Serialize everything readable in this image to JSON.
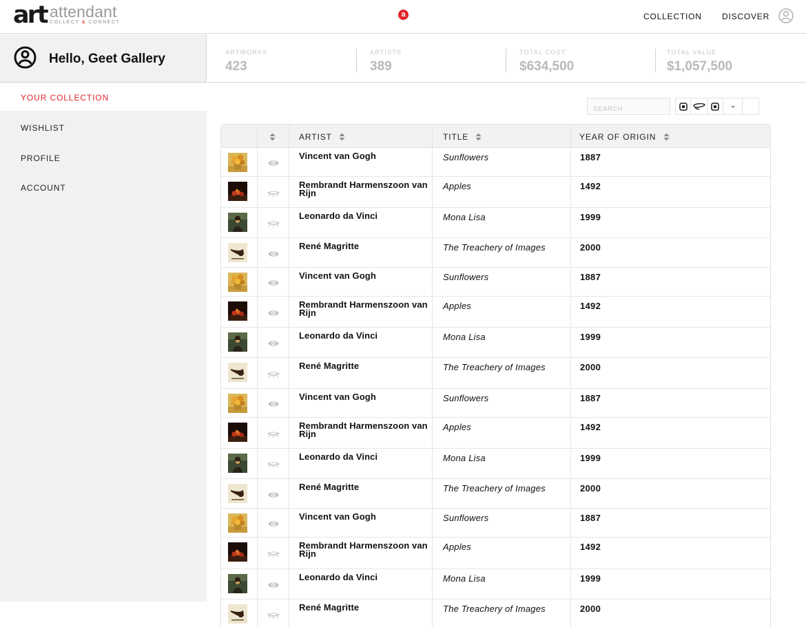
{
  "header": {
    "logo_mark": "art",
    "logo_word": "attendant",
    "logo_tag_left": "COLLECT ",
    "logo_tag_amp": "&",
    "logo_tag_right": " CONNECT",
    "center_badge": "a",
    "nav": {
      "collection": "COLLECTION",
      "discover": "DISCOVER"
    },
    "user_icon": "user-circle-icon"
  },
  "sidebar": {
    "greeting": "Hello, Geet Gallery",
    "greeting_icon": "user-circle-icon",
    "items": [
      {
        "label": "YOUR COLLECTION",
        "active": true
      },
      {
        "label": "WISHLIST",
        "active": false
      },
      {
        "label": "PROFILE",
        "active": false
      },
      {
        "label": "ACCOUNT",
        "active": false
      }
    ]
  },
  "stats": [
    {
      "label": "ARTWORKS",
      "value": "423"
    },
    {
      "label": "ARTISTS",
      "value": "389"
    },
    {
      "label": "TOTAL COST",
      "value": "$634,500"
    },
    {
      "label": "TOTAL VALUE",
      "value": "$1,057,500"
    }
  ],
  "toolbar": {
    "search_placeholder": "SEARCH",
    "view_buttons": [
      "grid-view-icon",
      "list-view-icon",
      "card-view-icon",
      "dropdown-icon"
    ]
  },
  "table": {
    "columns": {
      "artist": "ARTIST",
      "title": "TITLE",
      "year": "YEAR OF ORIGIN"
    },
    "rows": [
      {
        "artwork": "sunflowers",
        "visible": true,
        "artist": "Vincent van Gogh",
        "title": "Sunflowers",
        "year": "1887"
      },
      {
        "artwork": "apples",
        "visible": false,
        "artist": "Rembrandt Harmenszoon van Rijn",
        "title": "Apples",
        "year": "1492"
      },
      {
        "artwork": "mona-lisa",
        "visible": false,
        "artist": "Leonardo da Vinci",
        "title": "Mona Lisa",
        "year": "1999"
      },
      {
        "artwork": "pipe",
        "visible": true,
        "artist": "René Magritte",
        "title": "The Treachery of Images",
        "year": "2000"
      },
      {
        "artwork": "sunflowers",
        "visible": true,
        "artist": "Vincent van Gogh",
        "title": "Sunflowers",
        "year": "1887"
      },
      {
        "artwork": "apples",
        "visible": true,
        "artist": "Rembrandt Harmenszoon van Rijn",
        "title": "Apples",
        "year": "1492"
      },
      {
        "artwork": "mona-lisa",
        "visible": true,
        "artist": "Leonardo da Vinci",
        "title": "Mona Lisa",
        "year": "1999"
      },
      {
        "artwork": "pipe",
        "visible": false,
        "artist": "René Magritte",
        "title": "The Treachery of Images",
        "year": "2000"
      },
      {
        "artwork": "sunflowers",
        "visible": true,
        "artist": "Vincent van Gogh",
        "title": "Sunflowers",
        "year": "1887"
      },
      {
        "artwork": "apples",
        "visible": false,
        "artist": "Rembrandt Harmenszoon van Rijn",
        "title": "Apples",
        "year": "1492"
      },
      {
        "artwork": "mona-lisa",
        "visible": false,
        "artist": "Leonardo da Vinci",
        "title": "Mona Lisa",
        "year": "1999"
      },
      {
        "artwork": "pipe",
        "visible": true,
        "artist": "René Magritte",
        "title": "The Treachery of Images",
        "year": "2000"
      },
      {
        "artwork": "sunflowers",
        "visible": true,
        "artist": "Vincent van Gogh",
        "title": "Sunflowers",
        "year": "1887"
      },
      {
        "artwork": "apples",
        "visible": false,
        "artist": "Rembrandt Harmenszoon van Rijn",
        "title": "Apples",
        "year": "1492"
      },
      {
        "artwork": "mona-lisa",
        "visible": true,
        "artist": "Leonardo da Vinci",
        "title": "Mona Lisa",
        "year": "1999"
      },
      {
        "artwork": "pipe",
        "visible": false,
        "artist": "René Magritte",
        "title": "The Treachery of Images",
        "year": "2000"
      }
    ]
  },
  "colors": {
    "accent": "#e0262b",
    "sidebar_bg": "#f1f1f1",
    "muted": "#b9b9b9"
  }
}
